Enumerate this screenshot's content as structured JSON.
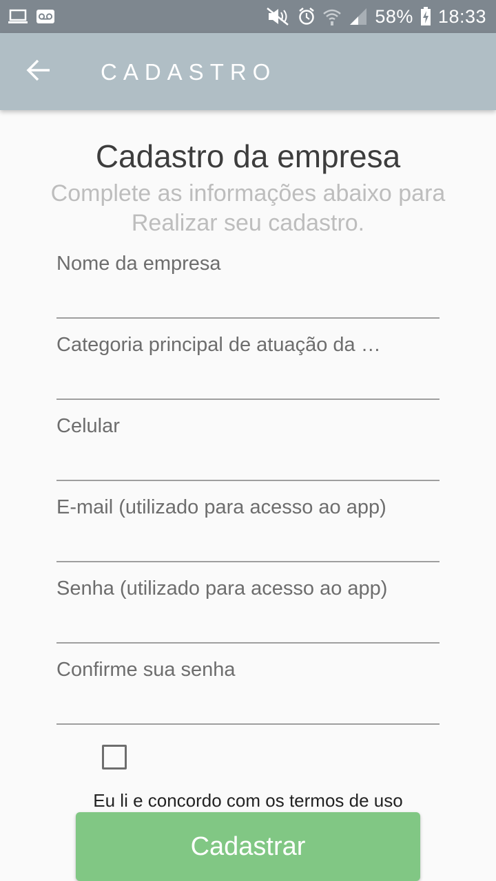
{
  "status_bar": {
    "battery": "58%",
    "time": "18:33",
    "icons": [
      "laptop-icon",
      "voicemail-icon",
      "mute-icon",
      "alarm-icon",
      "wifi-icon",
      "signal-icon",
      "battery-charging-icon"
    ]
  },
  "app_bar": {
    "title": "CADASTRO",
    "background": "#b0bec5"
  },
  "header": {
    "title": "Cadastro da empresa",
    "subtitle": "Complete as informações abaixo para Realizar seu cadastro."
  },
  "form": {
    "fields": [
      {
        "label": "Nome da empresa",
        "value": ""
      },
      {
        "label": "Categoria principal de atuação da …",
        "value": ""
      },
      {
        "label": "Celular",
        "value": ""
      },
      {
        "label": "E-mail (utilizado para acesso ao app)",
        "value": ""
      },
      {
        "label": "Senha (utilizado para acesso ao app)",
        "value": ""
      },
      {
        "label": "Confirme sua senha",
        "value": ""
      }
    ],
    "terms_checked": false,
    "terms_label": "Eu li e concordo com os termos de uso",
    "submit_label": "Cadastrar",
    "submit_color": "#81c784"
  }
}
